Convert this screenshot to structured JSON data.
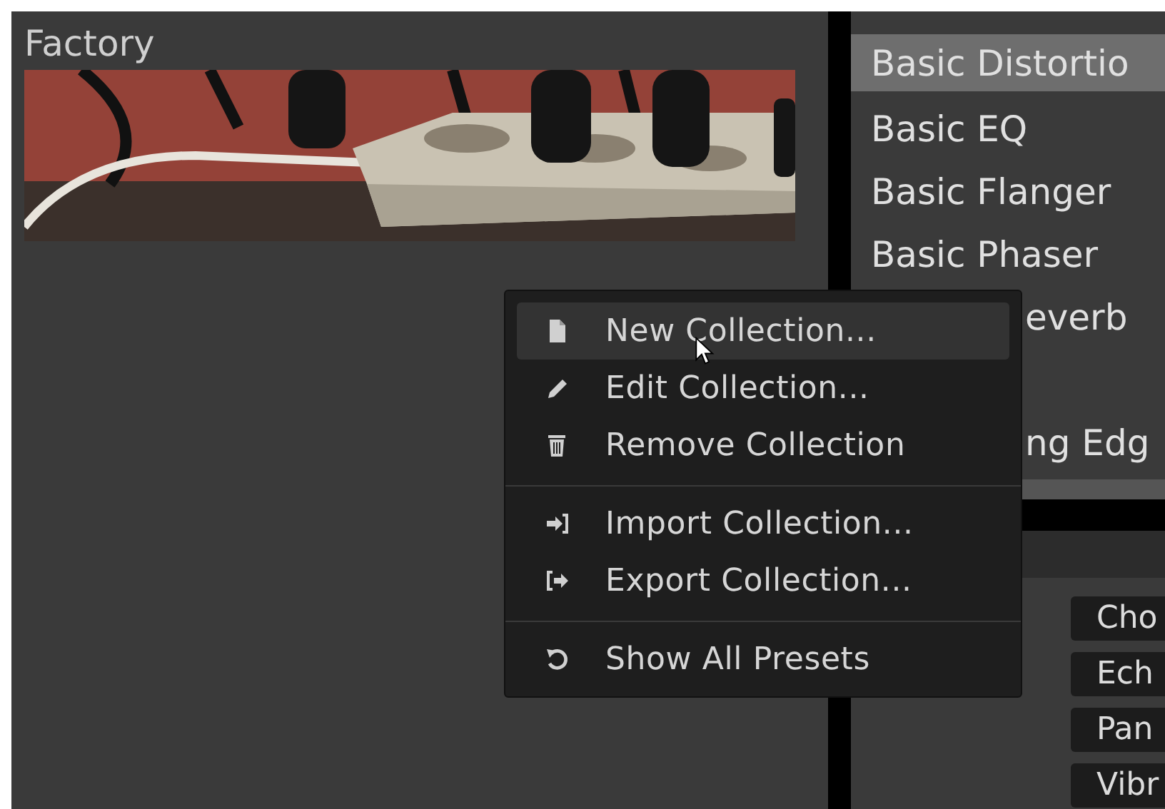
{
  "left_panel": {
    "title": "Factory"
  },
  "preset_list": {
    "items": [
      {
        "label": "Basic Distortio",
        "selected": true
      },
      {
        "label": "Basic EQ",
        "selected": false
      },
      {
        "label": "Basic Flanger",
        "selected": false
      },
      {
        "label": "Basic Phaser",
        "selected": false
      },
      {
        "label": "everb",
        "selected": false,
        "kind": "overlapped"
      },
      {
        "selected": false,
        "kind": "overlapped"
      },
      {
        "label": "ng Edg",
        "selected": false,
        "kind": "overlapped"
      }
    ]
  },
  "effect_buttons": [
    "Cho",
    "Ech",
    "Pan",
    "Vibr"
  ],
  "context_menu": {
    "groups": [
      [
        {
          "label": "New Collection...",
          "selected": true
        },
        {
          "label": "Edit Collection...",
          "selected": false
        },
        {
          "label": "Remove Collection",
          "selected": false
        }
      ],
      [
        {
          "label": "Import Collection...",
          "selected": false
        },
        {
          "label": "Export Collection...",
          "selected": false
        }
      ],
      [
        {
          "label": "Show All Presets",
          "selected": false
        }
      ]
    ]
  }
}
